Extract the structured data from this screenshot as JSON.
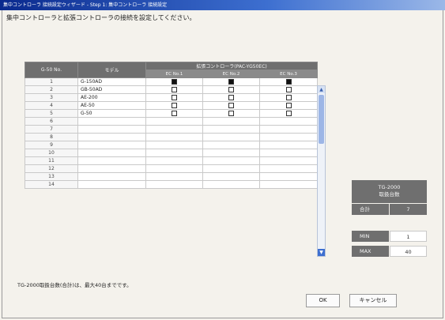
{
  "window": {
    "title": "集中コントローラ 接続設定ウィザード - Step 1: 集中コントローラ 接続設定"
  },
  "instruction": "集中コントローラと拡張コントローラの接続を設定してください。",
  "table": {
    "col_no_header": "G-50 No.",
    "col_model_header": "モデル",
    "group_header": "拡張コントローラ(PAC-YG50EC)",
    "ec_headers": [
      "EC No.1",
      "EC No.2",
      "EC No.3"
    ],
    "rows": [
      {
        "no": "1",
        "model": "G-150AD",
        "ec": [
          true,
          true,
          true
        ]
      },
      {
        "no": "2",
        "model": "GB-50AD",
        "ec": [
          false,
          false,
          false
        ]
      },
      {
        "no": "3",
        "model": "AE-200",
        "ec": [
          false,
          false,
          false
        ]
      },
      {
        "no": "4",
        "model": "AE-50",
        "ec": [
          false,
          false,
          false
        ]
      },
      {
        "no": "5",
        "model": "G-50",
        "ec": [
          false,
          false,
          false
        ]
      },
      {
        "no": "6",
        "model": "",
        "ec": null
      },
      {
        "no": "7",
        "model": "",
        "ec": null
      },
      {
        "no": "8",
        "model": "",
        "ec": null
      },
      {
        "no": "9",
        "model": "",
        "ec": null
      },
      {
        "no": "10",
        "model": "",
        "ec": null
      },
      {
        "no": "11",
        "model": "",
        "ec": null
      },
      {
        "no": "12",
        "model": "",
        "ec": null
      },
      {
        "no": "13",
        "model": "",
        "ec": null
      },
      {
        "no": "14",
        "model": "",
        "ec": null
      }
    ]
  },
  "summary": {
    "panel_title_1": "TG-2000",
    "panel_title_2": "取扱台数",
    "total_label": "合計",
    "total_value": "7",
    "min_label": "MIN",
    "min_value": "1",
    "max_label": "MAX",
    "max_value": "40"
  },
  "note": "TG-2000取扱台数(合計)は、最大40台までです。",
  "buttons": {
    "ok": "OK",
    "cancel": "キャンセル"
  },
  "colors": {
    "title_bar": "#0a2a8e",
    "header_bg": "#6f6f6f",
    "background": "#f4f2ec"
  }
}
